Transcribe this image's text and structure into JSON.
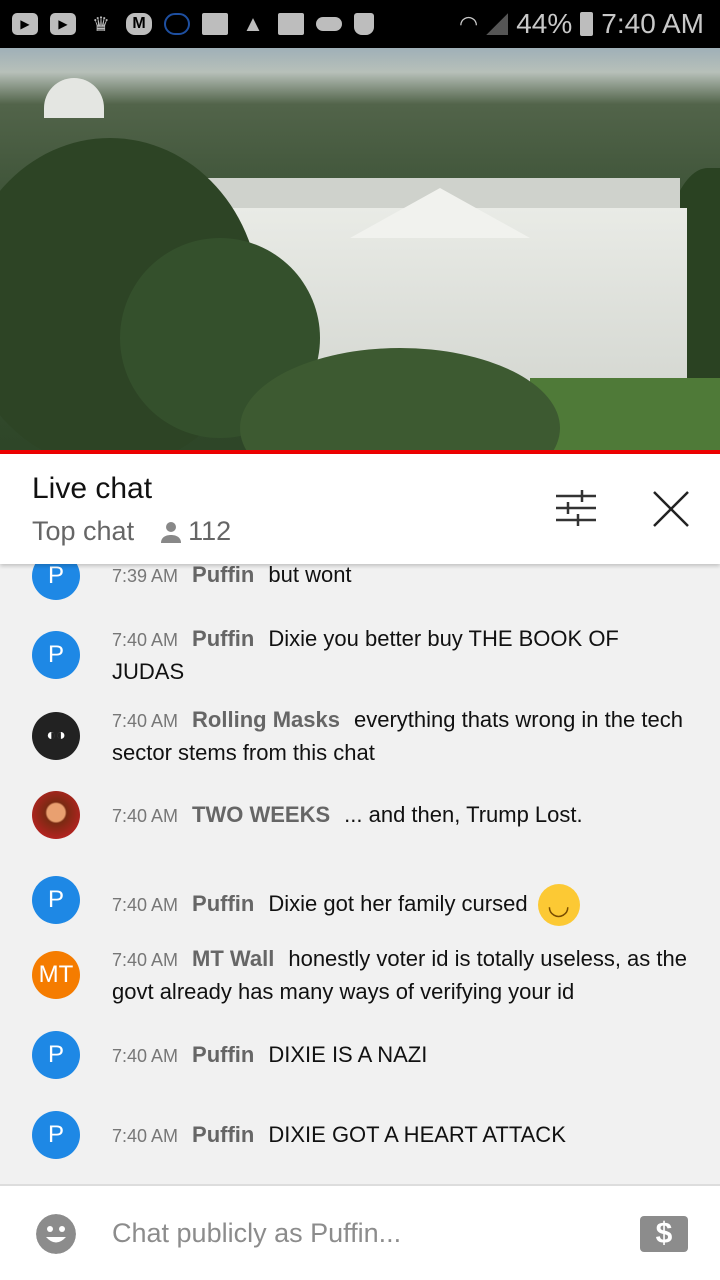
{
  "status_bar": {
    "battery": "44%",
    "time": "7:40 AM",
    "icons": [
      "youtube-icon",
      "youtube-icon",
      "crown-icon",
      "m-app-icon",
      "cloud-outline-icon",
      "folder-icon",
      "warning-icon",
      "image-icon",
      "cloud-icon",
      "bag-icon",
      "wifi-icon",
      "signal-icon",
      "battery-icon"
    ]
  },
  "header": {
    "title": "Live chat",
    "mode": "Top chat",
    "viewers": "112"
  },
  "messages": [
    {
      "avatar": "P",
      "color": "#1e88e5",
      "time": "7:39 AM",
      "author": "Puffin",
      "text": "but wont"
    },
    {
      "avatar": "P",
      "color": "#1e88e5",
      "time": "7:40 AM",
      "author": "Puffin",
      "text": "Dixie you better buy THE BOOK OF JUDAS"
    },
    {
      "avatar": "",
      "color": "#222222",
      "time": "7:40 AM",
      "author": "Rolling Masks",
      "text": "everything thats wrong in the tech sector stems from this chat"
    },
    {
      "avatar": "",
      "color": "#8a2a1a",
      "time": "7:40 AM",
      "author": "TWO WEEKS",
      "text": "... and then, Trump Lost."
    },
    {
      "avatar": "P",
      "color": "#1e88e5",
      "time": "7:40 AM",
      "author": "Puffin",
      "text": "Dixie got her family cursed"
    },
    {
      "avatar": "MT",
      "color": "#f57c00",
      "time": "7:40 AM",
      "author": "MT Wall",
      "text": "honestly voter id is totally useless, as the govt already has many ways of verifying your id"
    },
    {
      "avatar": "P",
      "color": "#1e88e5",
      "time": "7:40 AM",
      "author": "Puffin",
      "text": "DIXIE IS A NAZI"
    },
    {
      "avatar": "P",
      "color": "#1e88e5",
      "time": "7:40 AM",
      "author": "Puffin",
      "text": "DIXIE GOT A HEART ATTACK"
    }
  ],
  "input": {
    "placeholder": "Chat publicly as Puffin..."
  }
}
